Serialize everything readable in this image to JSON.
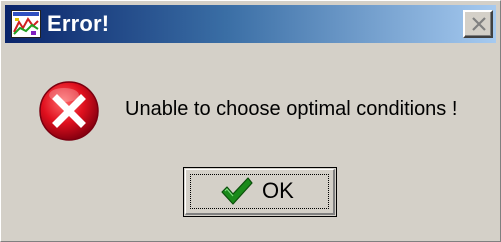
{
  "window": {
    "title": "Error!",
    "app_icon": "app-icon",
    "close_icon": "close-icon"
  },
  "dialog": {
    "status_icon": "error-icon",
    "message": "Unable to choose optimal conditions !"
  },
  "buttons": {
    "ok_label": "OK",
    "ok_icon": "checkmark-icon"
  },
  "colors": {
    "titlebar_start": "#0a246a",
    "titlebar_end": "#a6caf0",
    "dialog_bg": "#d4d0c8",
    "error_red": "#d0001a",
    "check_green": "#1a8a1a"
  }
}
